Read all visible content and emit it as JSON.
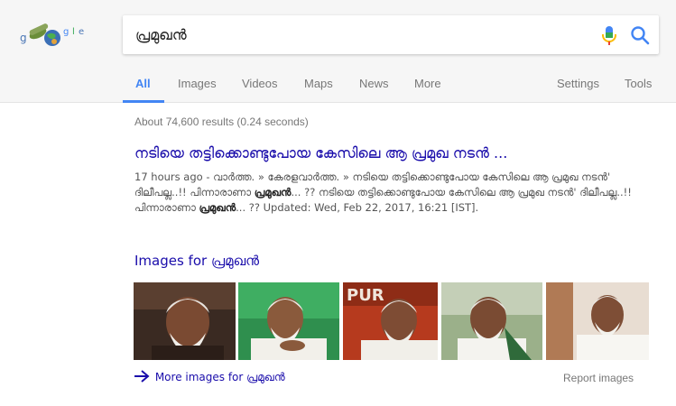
{
  "logo": {
    "letters": "g o  g l e"
  },
  "search": {
    "query": "പ്രമുഖൻ"
  },
  "tabs": [
    {
      "label": "All",
      "active": true
    },
    {
      "label": "Images"
    },
    {
      "label": "Videos"
    },
    {
      "label": "Maps"
    },
    {
      "label": "News"
    },
    {
      "label": "More"
    },
    {
      "label": "Settings"
    },
    {
      "label": "Tools"
    }
  ],
  "results_stats": "About 74,600 results (0.24 seconds)",
  "result": {
    "title": "നടിയെ തട്ടിക്കൊണ്ടുപോയ കേസിലെ ആ പ്രമുഖ നടൻ ...",
    "snippet_part1": "17 hours ago - വാർത്ത. » കേരളവാർത്ത. » നടിയെ തട്ടിക്കൊണ്ടുപോയ കേസിലെ ആ പ്രമുഖ നടൻ' ദിലീപല്ല..!! പിന്നാരാണാ ",
    "snippet_bold1": "പ്രമുഖൻ",
    "snippet_part2": "... ?? നടിയെ തട്ടിക്കൊണ്ടുപോയ കേസിലെ ആ പ്രമുഖ നടൻ' ദിലീപല്ല..!! പിന്നാരാണാ ",
    "snippet_bold2": "പ്രമുഖൻ",
    "snippet_part3": "... ?? Updated: Wed, Feb 22, 2017, 16:21 [IST]."
  },
  "images_section": {
    "header": "Images for പ്രമുഖൻ",
    "more_label": "More images for പ്രമുഖൻ",
    "report_label": "Report images",
    "thumb_overlay": "PUR"
  },
  "colors": {
    "link": "#1a0dab",
    "accent": "#4285f4",
    "muted": "#777777"
  }
}
